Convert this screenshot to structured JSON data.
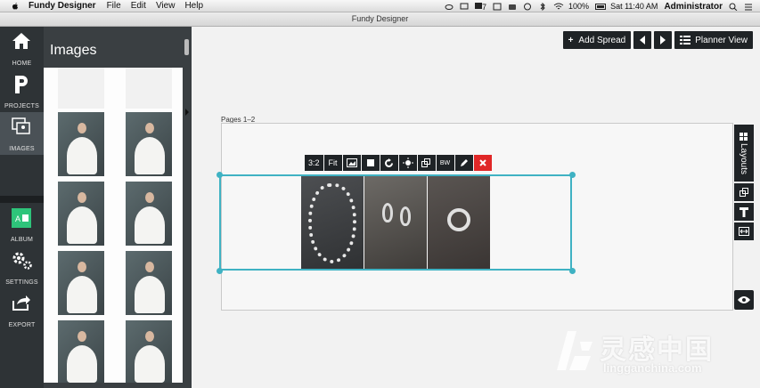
{
  "menubar": {
    "app_name": "Fundy Designer",
    "menus": [
      "File",
      "Edit",
      "View",
      "Help"
    ],
    "status_7": "7",
    "battery": "100%",
    "clock": "Sat 11:40 AM",
    "user": "Administrator"
  },
  "window": {
    "title": "Fundy Designer"
  },
  "nav": {
    "items": [
      {
        "label": "HOME",
        "icon": "home-icon"
      },
      {
        "label": "PROJECTS",
        "icon": "projects-icon"
      },
      {
        "label": "IMAGES",
        "icon": "images-icon"
      },
      {
        "label": "ALBUM",
        "icon": "album-icon"
      },
      {
        "label": "SETTINGS",
        "icon": "settings-icon"
      },
      {
        "label": "EXPORT",
        "icon": "export-icon"
      }
    ],
    "active": "IMAGES"
  },
  "images_panel": {
    "title": "Images"
  },
  "topbar": {
    "add_spread": "Add Spread",
    "planner_view": "Planner View"
  },
  "canvas": {
    "pages_label": "Pages 1–2"
  },
  "photo_toolbar": {
    "ratio": "3:2",
    "fit": "Fit",
    "bw": "BW"
  },
  "sidetools": {
    "layouts": "Layouts"
  },
  "watermark": {
    "cn": "灵感中国",
    "en": "lingganchina.com"
  },
  "colors": {
    "accent": "#3fb2c3",
    "dark": "#1f2326",
    "delete": "#e02727"
  }
}
